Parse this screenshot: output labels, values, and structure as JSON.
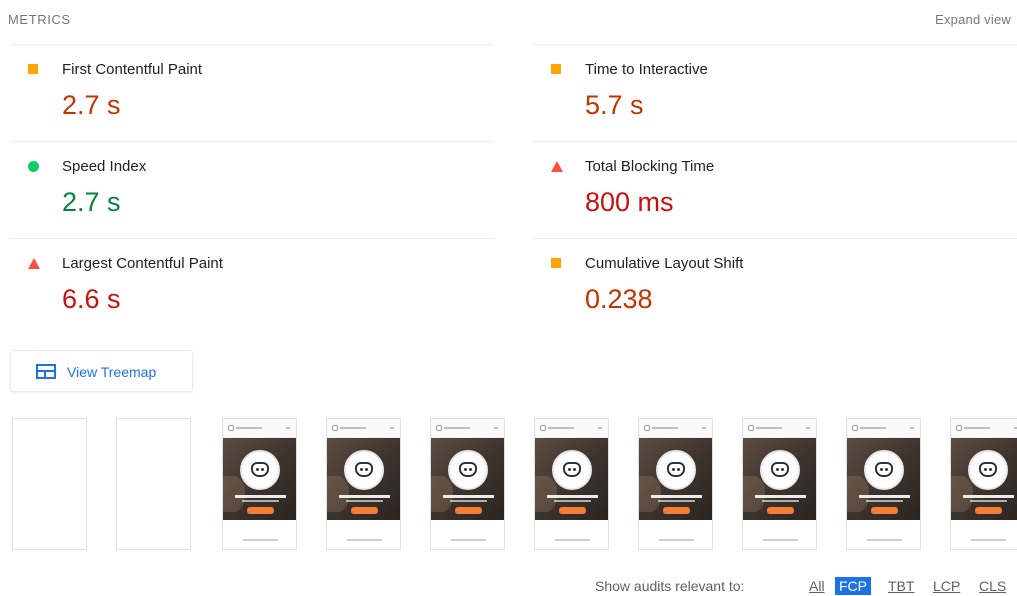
{
  "header": {
    "title": "METRICS",
    "expand_label": "Expand view"
  },
  "metrics": [
    {
      "title": "First Contentful Paint",
      "value": "2.7 s",
      "status": "average",
      "indicator": "square-icon"
    },
    {
      "title": "Time to Interactive",
      "value": "5.7 s",
      "status": "average",
      "indicator": "square-icon"
    },
    {
      "title": "Speed Index",
      "value": "2.7 s",
      "status": "pass",
      "indicator": "circle-icon"
    },
    {
      "title": "Total Blocking Time",
      "value": "800 ms",
      "status": "fail",
      "indicator": "triangle-icon"
    },
    {
      "title": "Largest Contentful Paint",
      "value": "6.6 s",
      "status": "fail",
      "indicator": "triangle-icon"
    },
    {
      "title": "Cumulative Layout Shift",
      "value": "0.238",
      "status": "average",
      "indicator": "square-icon"
    }
  ],
  "colors": {
    "average": "#ffa400",
    "pass": "#0cce6b",
    "fail": "#ff4e42",
    "link": "#1a73e8"
  },
  "treemap": {
    "label": "View Treemap",
    "icon": "treemap-icon"
  },
  "filmstrip": {
    "frames": [
      "blank",
      "blank",
      "loaded",
      "loaded",
      "loaded",
      "loaded",
      "loaded",
      "loaded",
      "loaded",
      "loaded"
    ]
  },
  "audit_filter": {
    "label": "Show audits relevant to:",
    "options": [
      "All",
      "FCP",
      "TBT",
      "LCP",
      "CLS"
    ],
    "selected": "FCP"
  }
}
